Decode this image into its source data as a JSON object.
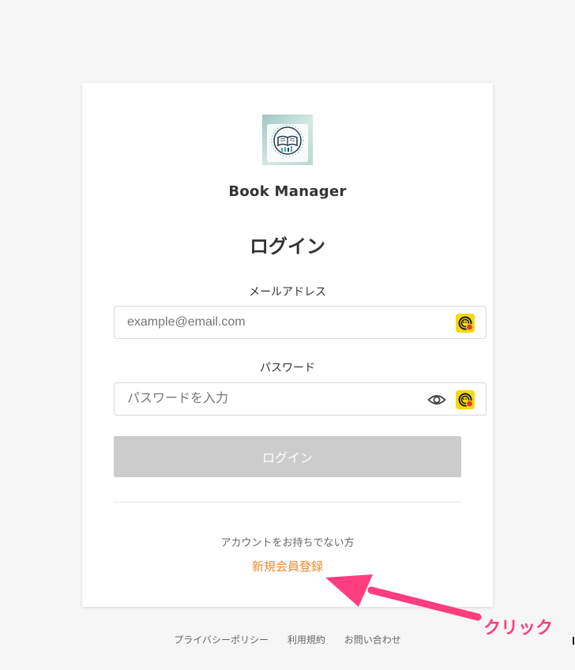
{
  "app": {
    "name": "Book Manager"
  },
  "login": {
    "heading": "ログイン",
    "email_label": "メールアドレス",
    "email_placeholder": "example@email.com",
    "email_value": "",
    "password_label": "パスワード",
    "password_placeholder": "パスワードを入力",
    "password_value": "",
    "submit_label": "ログイン",
    "no_account_text": "アカウントをお持ちでない方",
    "signup_link": "新規会員登録"
  },
  "footer": {
    "links": [
      "プライバシーポリシー",
      "利用規約",
      "お問い合わせ"
    ]
  },
  "annotation": {
    "text": "クリック",
    "color": "#ff3d7f"
  },
  "icons": {
    "logo": "book-logo-icon",
    "password_manager": "password-manager-extension-icon",
    "show_password": "eye-icon"
  },
  "colors": {
    "accent": "#f08a2c",
    "button_disabled": "#cccccc",
    "background": "#f6f6f6"
  }
}
